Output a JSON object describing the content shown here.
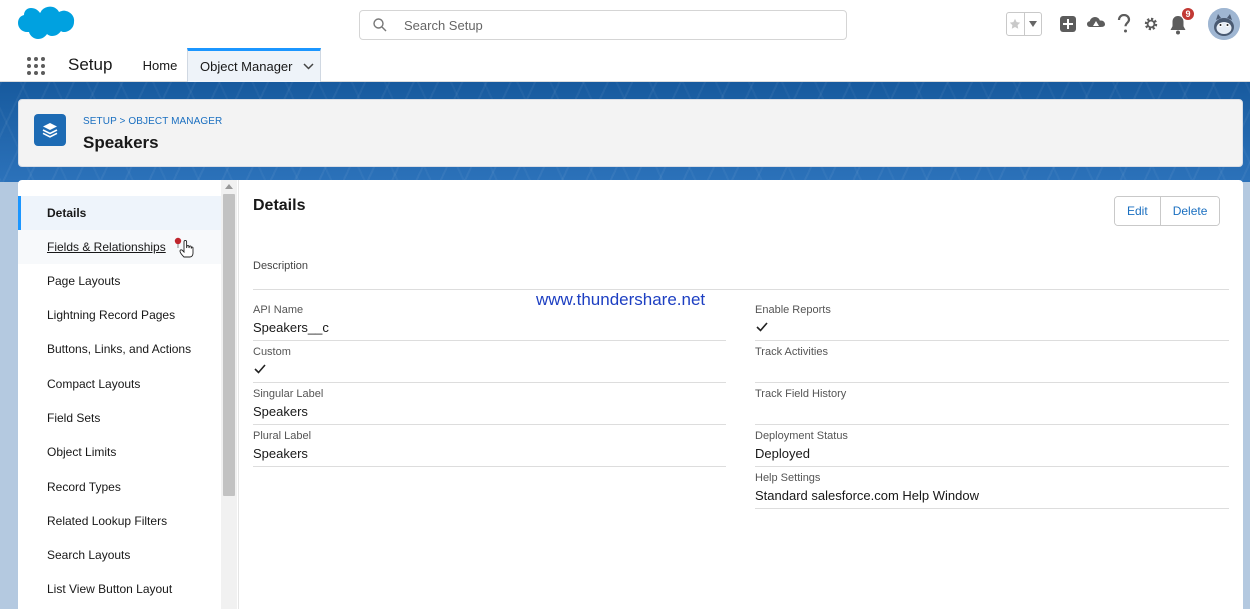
{
  "global_header": {
    "search_placeholder": "Search Setup",
    "notification_count": "9"
  },
  "nav": {
    "app_name": "Setup",
    "tabs": [
      {
        "label": "Home"
      },
      {
        "label": "Object Manager"
      }
    ]
  },
  "page_header": {
    "breadcrumb": "SETUP > OBJECT MANAGER",
    "title": "Speakers"
  },
  "sidebar": {
    "items": [
      {
        "label": "Details"
      },
      {
        "label": "Fields & Relationships"
      },
      {
        "label": "Page Layouts"
      },
      {
        "label": "Lightning Record Pages"
      },
      {
        "label": "Buttons, Links, and Actions"
      },
      {
        "label": "Compact Layouts"
      },
      {
        "label": "Field Sets"
      },
      {
        "label": "Object Limits"
      },
      {
        "label": "Record Types"
      },
      {
        "label": "Related Lookup Filters"
      },
      {
        "label": "Search Layouts"
      },
      {
        "label": "List View Button Layout"
      }
    ]
  },
  "details": {
    "title": "Details",
    "edit_label": "Edit",
    "delete_label": "Delete",
    "description_label": "Description",
    "watermark": "www.thundershare.net",
    "left_fields": [
      {
        "label": "API Name",
        "value": "Speakers__c"
      },
      {
        "label": "Custom",
        "checked": true
      },
      {
        "label": "Singular Label",
        "value": "Speakers"
      },
      {
        "label": "Plural Label",
        "value": "Speakers"
      }
    ],
    "right_fields": [
      {
        "label": "Enable Reports",
        "checked": true
      },
      {
        "label": "Track Activities",
        "value": ""
      },
      {
        "label": "Track Field History",
        "value": ""
      },
      {
        "label": "Deployment Status",
        "value": "Deployed"
      },
      {
        "label": "Help Settings",
        "value": "Standard salesforce.com Help Window"
      }
    ]
  },
  "colors": {
    "brand_blue": "#1b96ff",
    "link_blue": "#1a6fc0",
    "icon_blue": "#1d6bb4",
    "badge_red": "#c23934"
  }
}
